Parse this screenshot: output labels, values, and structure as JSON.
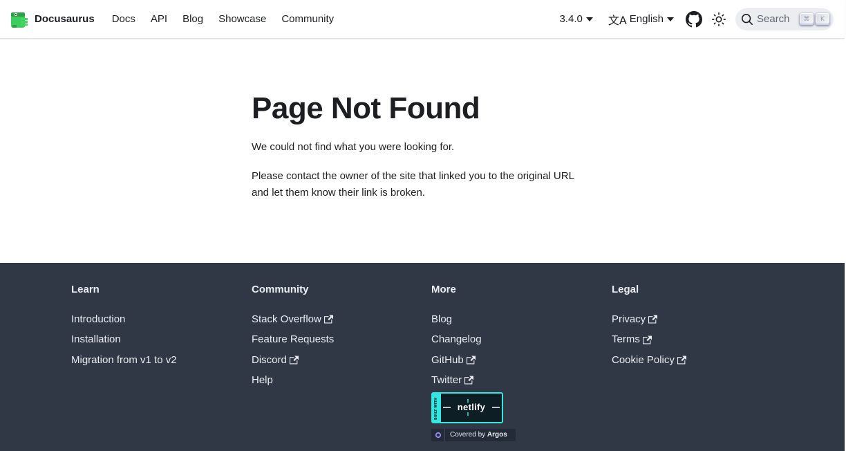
{
  "navbar": {
    "brand": "Docusaurus",
    "links": [
      "Docs",
      "API",
      "Blog",
      "Showcase",
      "Community"
    ],
    "version": "3.4.0",
    "language": "English",
    "search": {
      "label": "Search",
      "keys": [
        "⌘",
        "K"
      ]
    }
  },
  "main": {
    "title": "Page Not Found",
    "p1": "We could not find what you were looking for.",
    "p2_line1": "Please contact the owner of the site that linked you to the original URL",
    "p2_line2": "and let them know their link is broken."
  },
  "footer": {
    "learn": {
      "title": "Learn",
      "items": [
        "Introduction",
        "Installation",
        "Migration from v1 to v2"
      ]
    },
    "community": {
      "title": "Community",
      "items": [
        "Stack Overflow",
        "Feature Requests",
        "Discord",
        "Help"
      ]
    },
    "more": {
      "title": "More",
      "items": [
        "Blog",
        "Changelog",
        "GitHub",
        "Twitter"
      ]
    },
    "legal": {
      "title": "Legal",
      "items": [
        "Privacy",
        "Terms",
        "Cookie Policy"
      ]
    },
    "netlify_badge": {
      "top": "BUILT WITH",
      "text": "netlify"
    },
    "argos_badge": {
      "prefix": "Covered by",
      "name": "Argos"
    }
  },
  "colors": {
    "footer_bg": "#303846",
    "netlify_accent": "#32e6e2",
    "brand_green": "#3ecc5f"
  }
}
